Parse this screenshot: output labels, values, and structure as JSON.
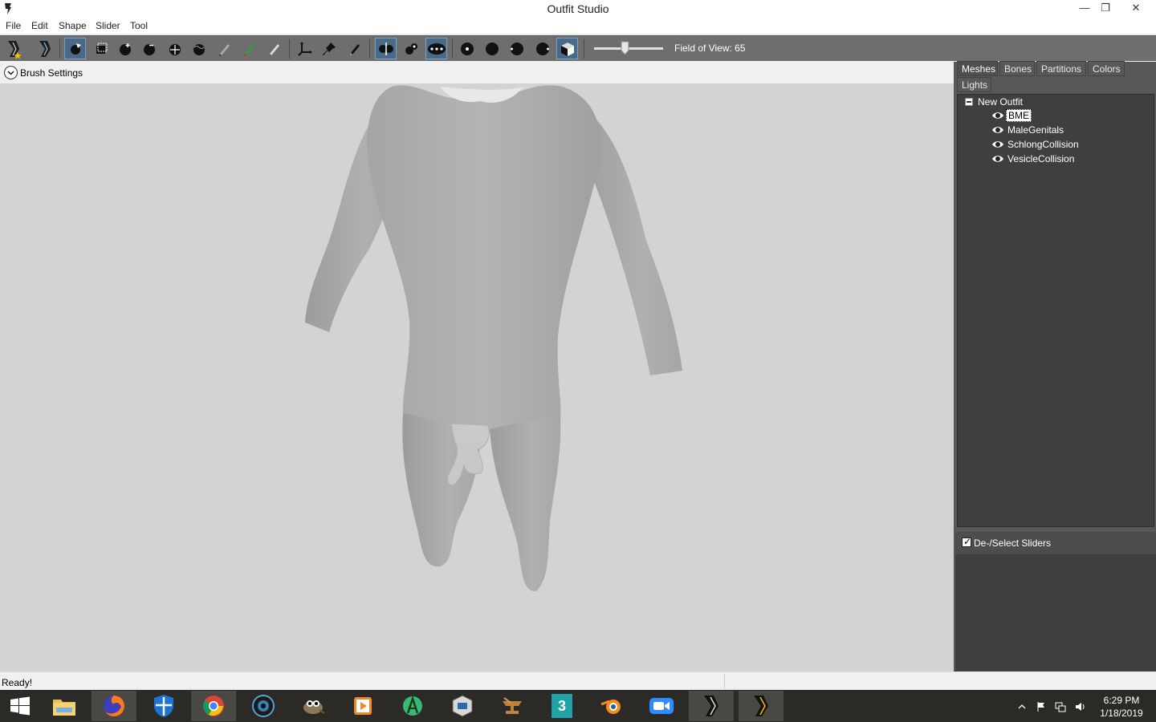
{
  "window": {
    "title": "Outfit Studio",
    "minimize_glyph": "—",
    "restore_glyph": "❐",
    "close_glyph": "✕"
  },
  "menu": [
    "File",
    "Edit",
    "Shape",
    "Slider",
    "Tool"
  ],
  "toolbar": {
    "fov_label": "Field of View: 65",
    "fov_value": 65,
    "tools": [
      "new-project-icon",
      "load-outfit-icon",
      "select-brush-icon",
      "mask-brush-icon",
      "inflate-brush-icon",
      "deflate-brush-icon",
      "move-brush-icon",
      "smooth-brush-icon",
      "undiff-brush-icon",
      "weight-brush-icon",
      "color-brush-icon",
      "alpha-brush-icon",
      "transform-icon",
      "pivot-icon",
      "vertex-edit-icon",
      "x-mirror-icon",
      "connected-icon",
      "global-brush-icon",
      "view-front-icon",
      "view-back-icon",
      "view-left-icon",
      "view-right-icon",
      "perspective-icon"
    ]
  },
  "brush_settings": {
    "label": "Brush Settings"
  },
  "tabs": [
    {
      "label": "Meshes",
      "active": true
    },
    {
      "label": "Bones",
      "active": false
    },
    {
      "label": "Partitions",
      "active": false
    },
    {
      "label": "Colors",
      "active": false
    },
    {
      "label": "Lights",
      "active": false
    }
  ],
  "mesh_tree": {
    "root": "New Outfit",
    "items": [
      {
        "label": "BME",
        "selected": true
      },
      {
        "label": "MaleGenitals",
        "selected": false
      },
      {
        "label": "SchlongCollision",
        "selected": false
      },
      {
        "label": "VesicleCollision",
        "selected": false
      }
    ]
  },
  "sliders": {
    "toggle_label": "De-/Select Sliders",
    "checked": true
  },
  "status": {
    "text": "Ready!"
  },
  "taskbar": {
    "apps": [
      "windows-start-icon",
      "file-explorer-icon",
      "firefox-icon",
      "windows-defender-icon",
      "chrome-icon",
      "camera-app-icon",
      "gimp-icon",
      "media-player-icon",
      "android-studio-icon",
      "virtualbox-icon",
      "anvil-app-icon",
      "3ds-max-icon",
      "blender-icon",
      "zoom-icon",
      "outfit-studio-icon",
      "bodyslide-icon"
    ],
    "max_label": "3",
    "time": "6:29 PM",
    "date": "1/18/2019"
  },
  "colors": {
    "toolbar_bg": "#6e6e6e",
    "viewport_bg": "#d3d3d3",
    "panel_bg": "#3f3f3f",
    "taskbar_bg": "#2b2a27"
  }
}
